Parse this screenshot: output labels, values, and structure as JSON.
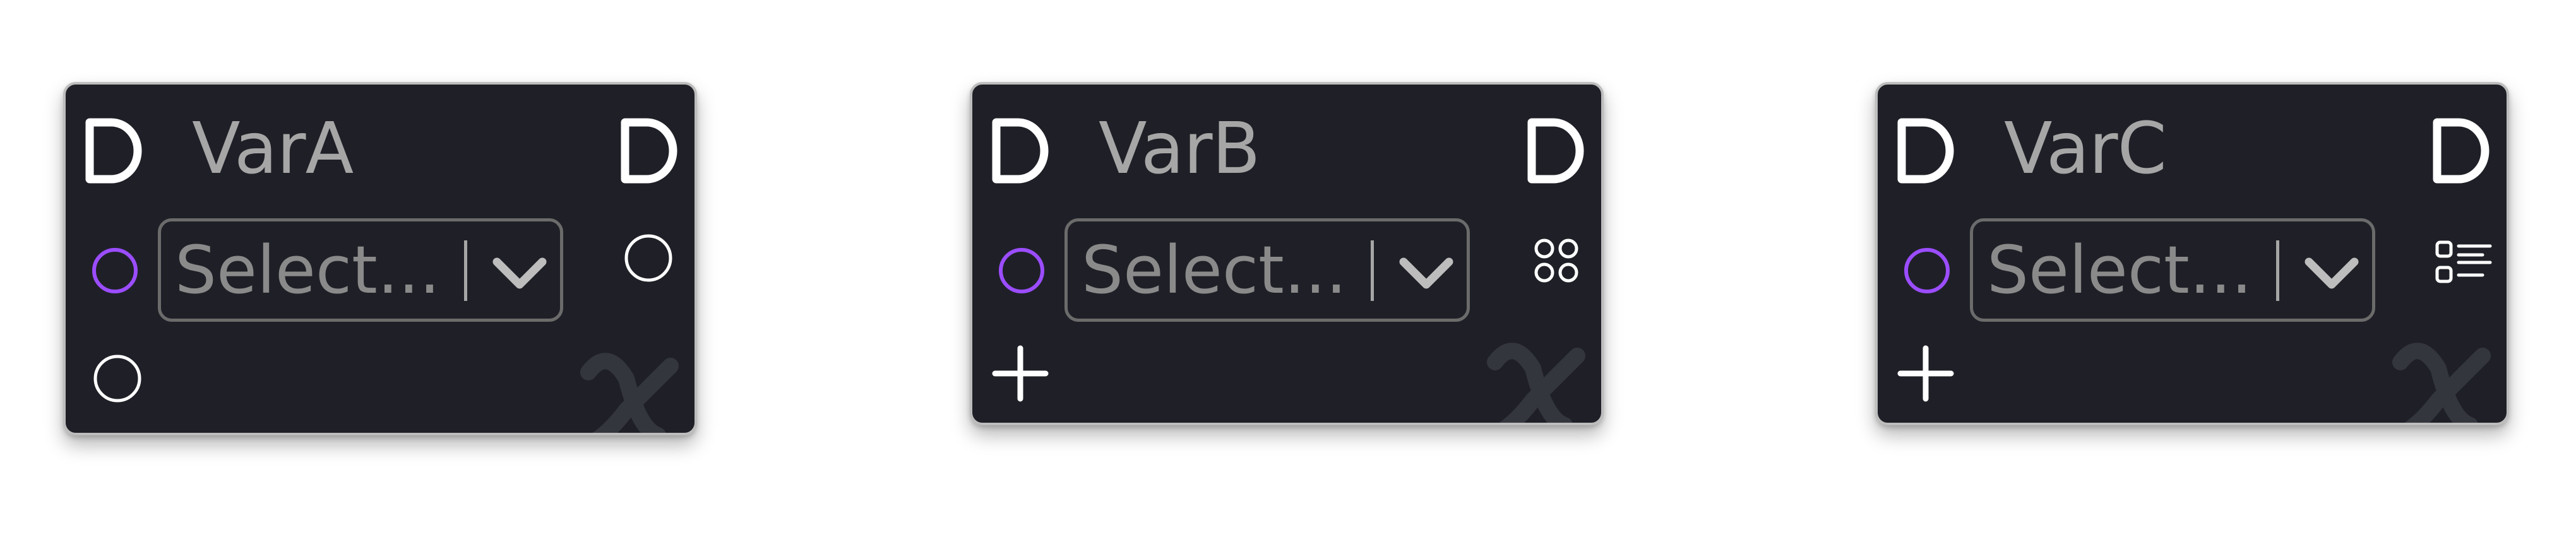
{
  "nodes": [
    {
      "title": "VarA",
      "select_placeholder": "Select..."
    },
    {
      "title": "VarB",
      "select_placeholder": "Select..."
    },
    {
      "title": "VarC",
      "select_placeholder": "Select..."
    }
  ],
  "colors": {
    "node_bg": "#1f2027",
    "node_border": "#bdbdbd",
    "title_text": "#a6a6a6",
    "placeholder_text": "#8a8a8a",
    "input_port": "#9b4dff",
    "icon_white": "#ffffff",
    "watermark": "#34363e"
  },
  "icons": {
    "header_left": "d-icon",
    "header_right": "d-icon",
    "input_port": "circle-port-purple",
    "output_port": "circle-port-white",
    "add": "plus-icon",
    "grid": "grid-icon",
    "list": "list-icon",
    "watermark": "function-x-icon"
  }
}
